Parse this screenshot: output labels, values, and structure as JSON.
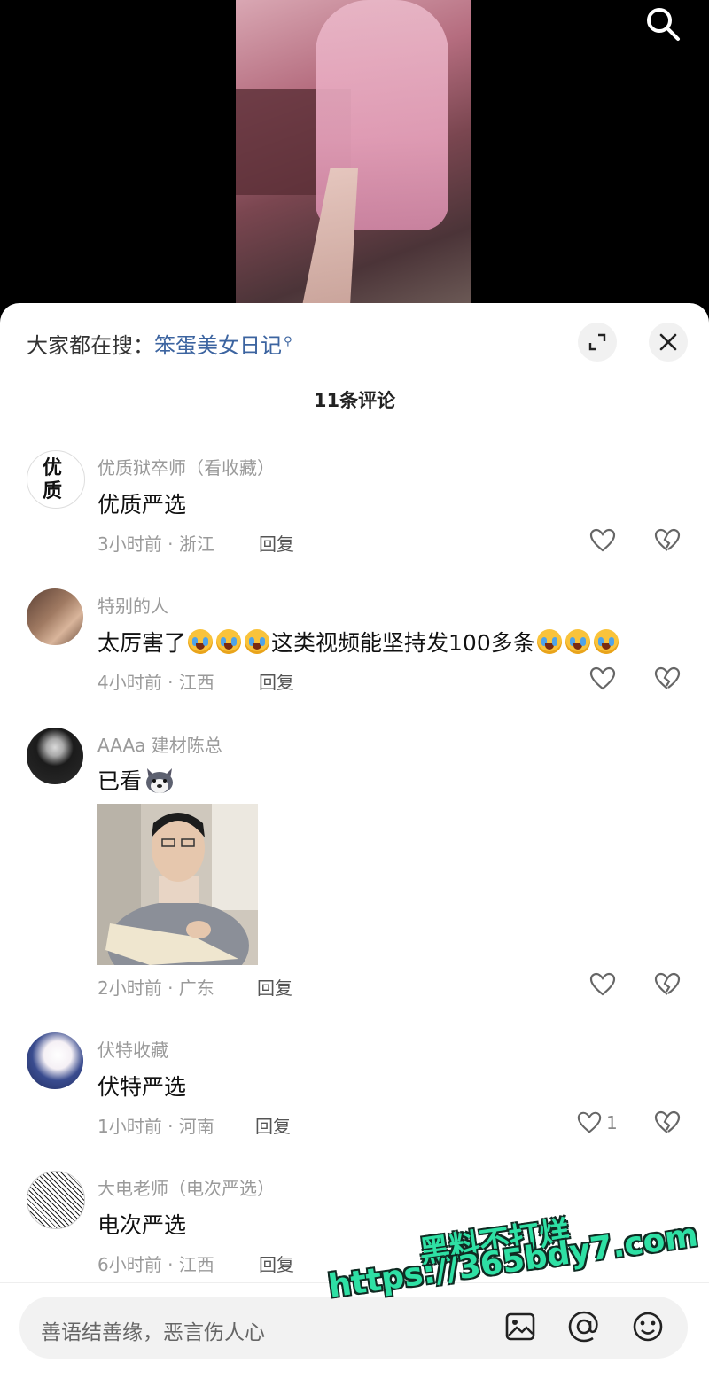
{
  "hot_search": {
    "prefix": "大家都在搜：",
    "keyword": "笨蛋美女日记"
  },
  "comment_count_title": "11条评论",
  "comments": [
    {
      "name": "优质狱卒师（看收藏）",
      "avatar_text": "优质",
      "text": "优质严选",
      "time": "3小时前 · 浙江",
      "reply": "回复",
      "likes": ""
    },
    {
      "name": "特别的人",
      "text_before": "太厉害了",
      "text_middle": "这类视频能坚持发100多条",
      "time": "4小时前 · 江西",
      "reply": "回复",
      "likes": ""
    },
    {
      "name": "AAAa 建材陈总",
      "text": "已看",
      "time": "2小时前 · 广东",
      "reply": "回复",
      "likes": ""
    },
    {
      "name": "伏特收藏",
      "text": "伏特严选",
      "time": "1小时前 · 河南",
      "reply": "回复",
      "likes": "1"
    },
    {
      "name": "大电老师（电次严选）",
      "text": "电次严选",
      "time": "6小时前 · 江西",
      "reply": "回复",
      "likes": ""
    }
  ],
  "input": {
    "placeholder": "善语结善缘，恶言伤人心"
  },
  "watermark": {
    "line1": "黑料不打烊",
    "line2": "https://365bdy7.com"
  },
  "icons": [
    "search-icon",
    "expand-icon",
    "close-icon",
    "heart-icon",
    "broken-heart-icon",
    "image-icon",
    "at-icon",
    "emoji-icon"
  ]
}
